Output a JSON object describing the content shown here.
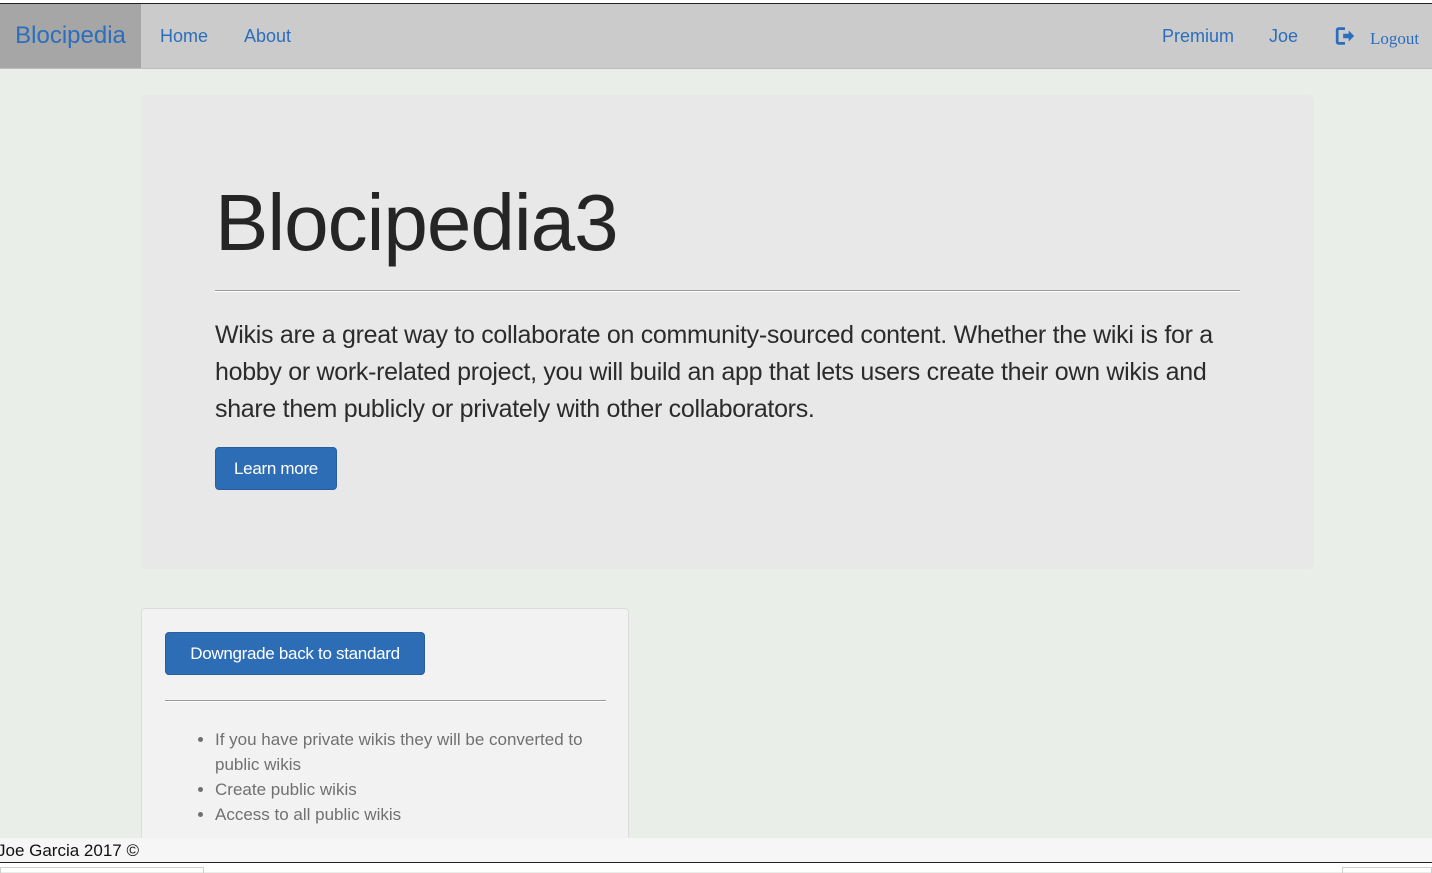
{
  "navbar": {
    "brand": "Blocipedia",
    "links": {
      "home": "Home",
      "about": "About",
      "premium": "Premium",
      "user": "Joe",
      "logout": "Logout"
    }
  },
  "jumbotron": {
    "title": "Blocipedia3",
    "lead": "Wikis are a great way to collaborate on community-sourced content. Whether the wiki is for a hobby or work-related project, you will build an app that lets users create their own wikis and share them publicly or privately with other collaborators.",
    "learn_more": "Learn more"
  },
  "plan_panel": {
    "downgrade_button": "Downgrade back to standard",
    "items": [
      "If you have private wikis they will be converted to public wikis",
      "Create public wikis",
      "Access to all public wikis"
    ]
  },
  "footer": {
    "copyright": "Joe Garcia 2017 ©"
  },
  "colors": {
    "primary": "#2d6db5",
    "link": "#2a6ebd",
    "background": "#e9eee8",
    "navbar": "#cbcbcb",
    "brand_bg": "#a6a6a6"
  }
}
